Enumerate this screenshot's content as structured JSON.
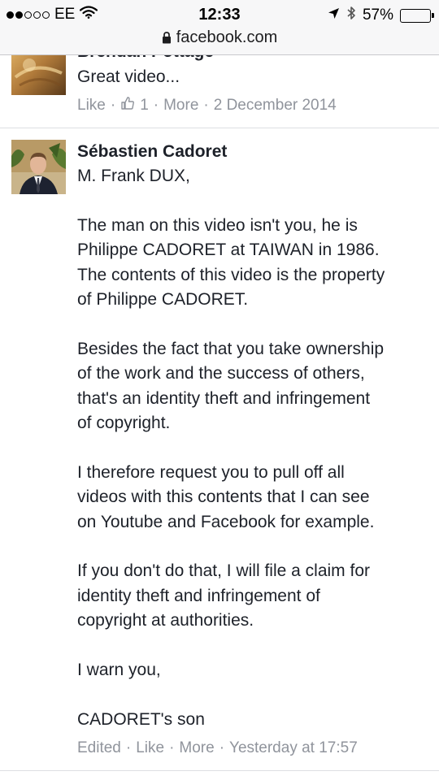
{
  "status_bar": {
    "carrier": "EE",
    "time": "12:33",
    "battery": "57%",
    "battery_level": 0.57
  },
  "browser": {
    "url": "facebook.com"
  },
  "comments": [
    {
      "author": "Brendan Pottage",
      "body": [
        "Great video..."
      ],
      "meta": {
        "like": "Like",
        "like_count": "1",
        "more": "More",
        "time": "2 December 2014"
      }
    },
    {
      "author": "Sébastien Cadoret",
      "body": [
        "M. Frank DUX,",
        "",
        "The man on this video isn't you, he is",
        "Philippe CADORET at TAIWAN in 1986.",
        "The contents of this video is the property",
        "of Philippe CADORET.",
        "",
        "Besides the fact that you take ownership",
        "of the work and the success of others,",
        "that's an identity theft and infringement",
        "of copyright.",
        "",
        "I therefore request you to pull off all",
        "videos with this contents that I can see",
        "on Youtube and Facebook for example.",
        "",
        "If you don't do that, I will file a claim for",
        "identity theft and infringement of",
        "copyright at authorities.",
        "",
        "I warn you,",
        "",
        "CADORET's son"
      ],
      "meta": {
        "edited": "Edited",
        "like": "Like",
        "more": "More",
        "time": "Yesterday at 17:57"
      }
    }
  ]
}
